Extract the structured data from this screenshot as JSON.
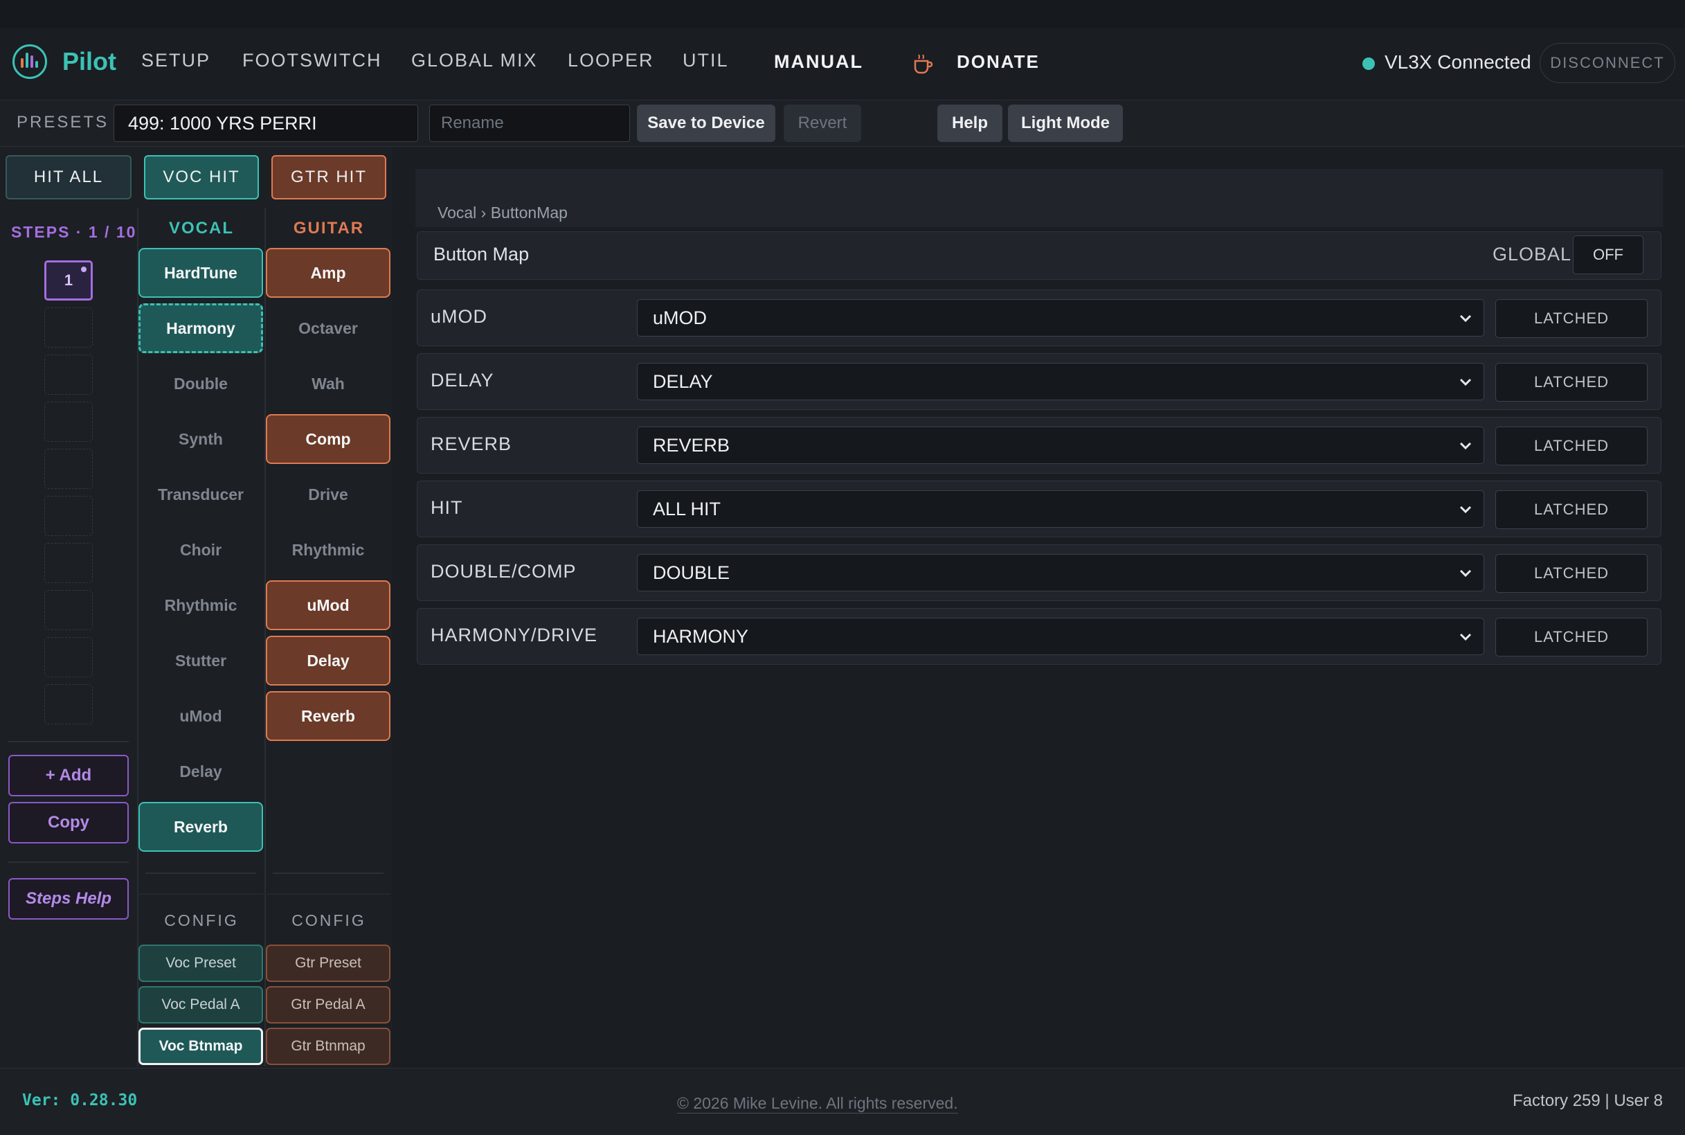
{
  "nav": {
    "brand": "Pilot",
    "links": [
      "SETUP",
      "FOOTSWITCH",
      "GLOBAL MIX",
      "LOOPER",
      "UTIL",
      "MANUAL"
    ],
    "donate": "DONATE",
    "status": "VL3X Connected",
    "disconnect": "DISCONNECT",
    "colors": {
      "accent": "#3cc2b5",
      "guitar": "#e07a52",
      "steps": "#a56ee0"
    }
  },
  "presets": {
    "label": "PRESETS",
    "current": "499: 1000 YRS PERRI",
    "rename_placeholder": "Rename",
    "save": "Save to Device",
    "revert": "Revert",
    "help": "Help",
    "light_mode": "Light Mode"
  },
  "hits": {
    "all": "HIT ALL",
    "voc": "VOC HIT",
    "gtr": "GTR HIT"
  },
  "steps": {
    "label": "STEPS · 1 / 10",
    "active": "1",
    "add": "+ Add",
    "copy": "Copy",
    "help": "Steps Help"
  },
  "vocal": {
    "header": "VOCAL",
    "effects": [
      "HardTune",
      "Harmony",
      "Double",
      "Synth",
      "Transducer",
      "Choir",
      "Rhythmic",
      "Stutter",
      "uMod",
      "Delay",
      "Reverb"
    ],
    "config_header": "CONFIG",
    "config": [
      "Voc Preset",
      "Voc Pedal A",
      "Voc Btnmap"
    ]
  },
  "guitar": {
    "header": "GUITAR",
    "effects": [
      "Amp",
      "Octaver",
      "Wah",
      "Comp",
      "Drive",
      "Rhythmic",
      "uMod",
      "Delay",
      "Reverb"
    ],
    "config_header": "CONFIG",
    "config": [
      "Gtr Preset",
      "Gtr Pedal A",
      "Gtr Btnmap"
    ]
  },
  "panel": {
    "breadcrumb": "Vocal › ButtonMap",
    "title": "Button Map",
    "global_label": "GLOBAL",
    "global_value": "OFF",
    "rows": [
      {
        "label": "uMOD",
        "value": "uMOD",
        "mode": "LATCHED"
      },
      {
        "label": "DELAY",
        "value": "DELAY",
        "mode": "LATCHED"
      },
      {
        "label": "REVERB",
        "value": "REVERB",
        "mode": "LATCHED"
      },
      {
        "label": "HIT",
        "value": "ALL HIT",
        "mode": "LATCHED"
      },
      {
        "label": "DOUBLE/COMP",
        "value": "DOUBLE",
        "mode": "LATCHED"
      },
      {
        "label": "HARMONY/DRIVE",
        "value": "HARMONY",
        "mode": "LATCHED"
      }
    ]
  },
  "footer": {
    "version": "Ver: 0.28.30",
    "copyright": "© 2026 Mike Levine. All rights reserved.",
    "counts": "Factory 259 | User 8"
  }
}
